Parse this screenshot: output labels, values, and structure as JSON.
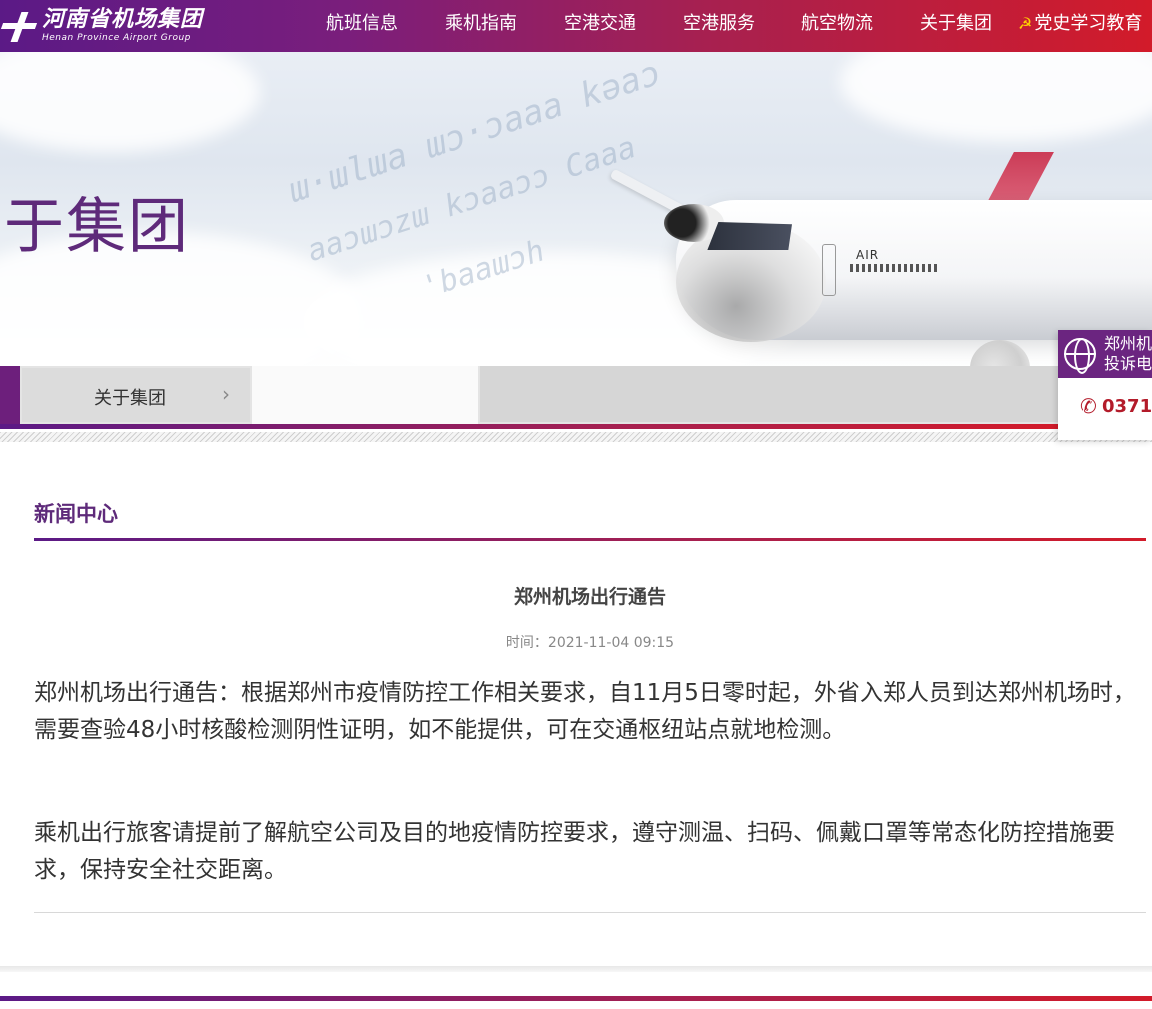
{
  "header": {
    "logo_cn": "河南省机场集团",
    "logo_en": "Henan Province Airport Group",
    "nav": [
      "航班信息",
      "乘机指南",
      "空港交通",
      "空港服务",
      "航空物流",
      "关于集团",
      "党史学习教育"
    ]
  },
  "banner": {
    "title": "于集团",
    "plane_text": "AIR"
  },
  "breadcrumb": {
    "item": "关于集团",
    "arrow": "›"
  },
  "complaint": {
    "line1": "郑州机",
    "line2": "投诉电",
    "phone_icon": "✆",
    "phone": "0371-"
  },
  "content": {
    "section_title": "新闻中心",
    "article_title": "郑州机场出行通告",
    "time": "时间：2021-11-04 09:15",
    "paragraphs": [
      "郑州机场出行通告：根据郑州市疫情防控工作相关要求，自11月5日零时起，外省入郑人员到达郑州机场时，需要查验48小时核酸检测阴性证明，如不能提供，可在交通枢纽站点就地检测。",
      "乘机出行旅客请提前了解航空公司及目的地疫情防控要求，遵守测温、扫码、佩戴口罩等常态化防控措施要求，保持安全社交距离。"
    ]
  },
  "colors": {
    "brand_purple": "#5e2a7a",
    "brand_red": "#d21b2a"
  }
}
